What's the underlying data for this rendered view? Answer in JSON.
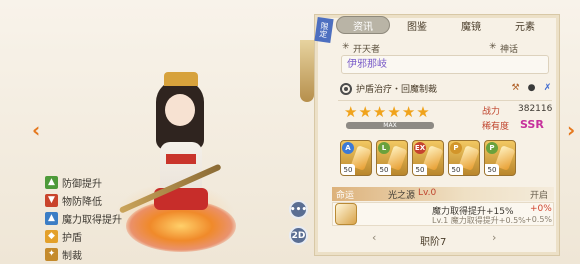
{
  "nav": {
    "prev_arrow": "‹",
    "next_arrow": "›"
  },
  "tabs": [
    {
      "label": "资讯",
      "active": true
    },
    {
      "label": "图鉴",
      "active": false
    },
    {
      "label": "魔镜",
      "active": false
    },
    {
      "label": "元素",
      "active": false
    }
  ],
  "badge": "限定",
  "buffs": [
    {
      "label": "防御提升",
      "icon": "shield-up-icon",
      "color": "#4e9a3a"
    },
    {
      "label": "物防降低",
      "icon": "armor-down-icon",
      "color": "#c9442c"
    },
    {
      "label": "魔力取得提升",
      "icon": "magic-up-icon",
      "color": "#3b7dc5"
    },
    {
      "label": "护盾",
      "icon": "shield-icon",
      "color": "#e3a02a"
    },
    {
      "label": "制裁",
      "icon": "sanction-icon",
      "color": "#c48a2c"
    }
  ],
  "side_buttons": {
    "chat": "•••",
    "mode": "2D"
  },
  "profile": {
    "section_left": "开天者",
    "section_right": "神话",
    "name": "伊邪那岐",
    "skill_desc": "护盾治疗・回魔制裁",
    "power_label": "战力",
    "power_value": "382116",
    "rarity_label": "稀有度",
    "rarity_value": "SSR",
    "stars": 6,
    "max_label": "MAX"
  },
  "equipment": [
    {
      "badge": "A",
      "level": "50",
      "color": "#3c7ad6"
    },
    {
      "badge": "L",
      "level": "50",
      "color": "#6aa13c"
    },
    {
      "badge": "EX",
      "level": "50",
      "color": "#c6432f"
    },
    {
      "badge": "P",
      "level": "50",
      "color": "#d2952a"
    },
    {
      "badge": "P",
      "level": "50",
      "color": "#6aa13c"
    }
  ],
  "rune": {
    "tab_label": "命运",
    "title": "光之源",
    "level": "Lv.0",
    "status": "开启",
    "effect_current": "魔力取得提升+15%",
    "effect_current_value": "+0%",
    "effect_next": "Lv.1 魔力取得提升+0.5%",
    "effect_next_value": "+0.5%"
  },
  "footer": {
    "label": "职阶7",
    "prev": "‹",
    "next": "›"
  }
}
